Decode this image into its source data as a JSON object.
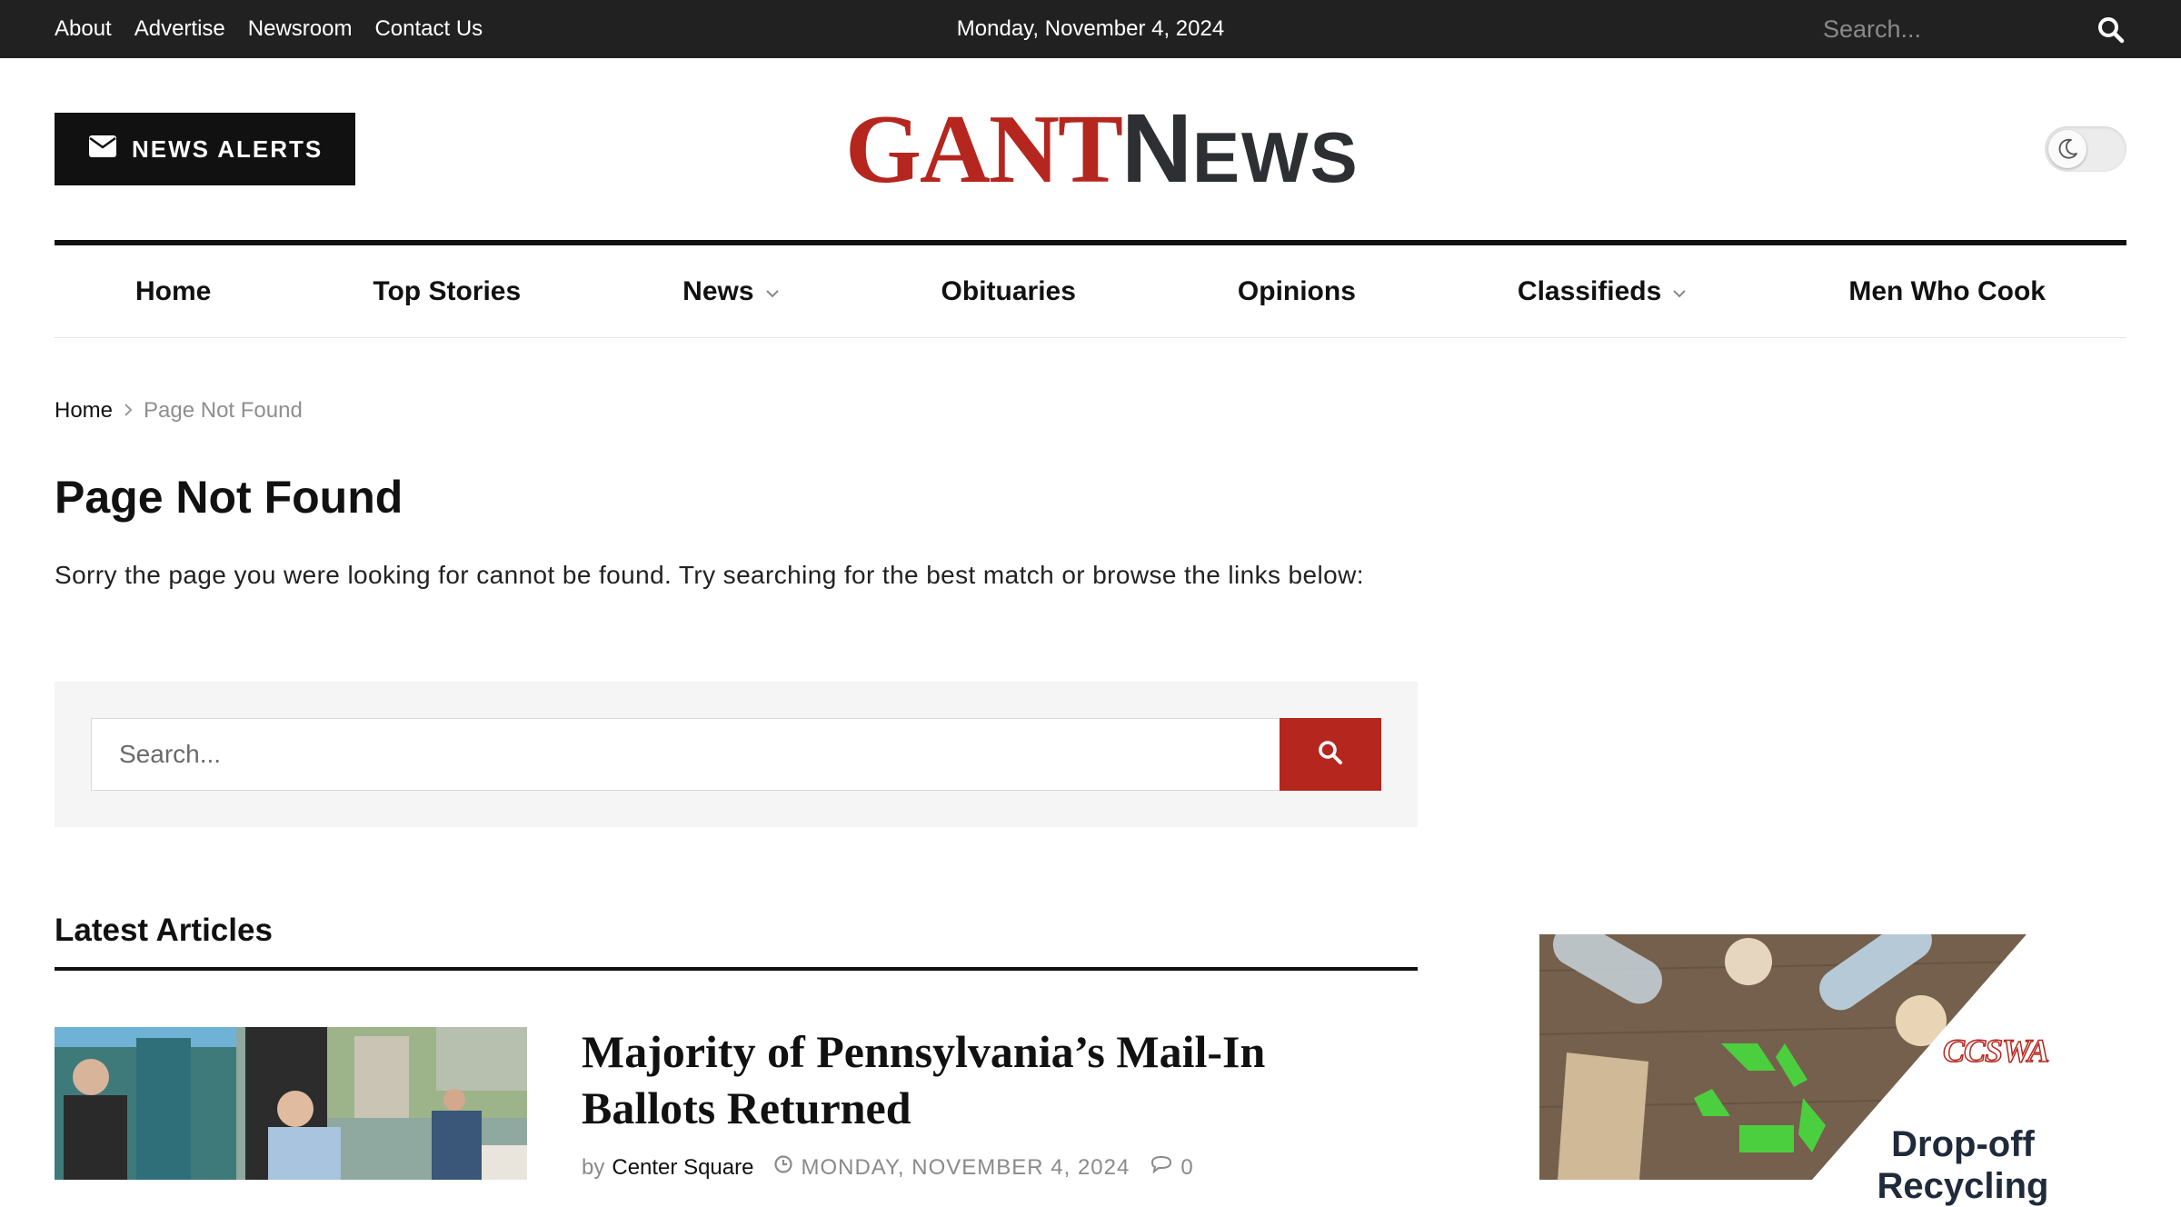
{
  "topbar": {
    "links": [
      "About",
      "Advertise",
      "Newsroom",
      "Contact Us"
    ],
    "date": "Monday, November 4, 2024",
    "search_placeholder": "Search..."
  },
  "header": {
    "alerts_label": "NEWS ALERTS",
    "logo": {
      "part1": "GANT",
      "part2": "N",
      "part3": "EWS"
    }
  },
  "nav": {
    "items": [
      {
        "label": "Home",
        "dropdown": false
      },
      {
        "label": "Top Stories",
        "dropdown": false
      },
      {
        "label": "News",
        "dropdown": true
      },
      {
        "label": "Obituaries",
        "dropdown": false
      },
      {
        "label": "Opinions",
        "dropdown": false
      },
      {
        "label": "Classifieds",
        "dropdown": true
      },
      {
        "label": "Men Who Cook",
        "dropdown": false
      }
    ]
  },
  "breadcrumb": {
    "home": "Home",
    "current": "Page Not Found"
  },
  "page": {
    "title": "Page Not Found",
    "message": "Sorry the page you were looking for cannot be found. Try searching for the best match or browse the links below:",
    "search_placeholder": "Search..."
  },
  "latest": {
    "heading": "Latest Articles",
    "articles": [
      {
        "title": "Majority of Pennsylvania’s Mail-In Ballots Returned",
        "by": "by",
        "author": "Center Square",
        "date": "MONDAY, NOVEMBER 4, 2024",
        "comments": "0"
      }
    ]
  },
  "ad": {
    "brand": "CCSWA",
    "text": "Drop-off Recycling"
  },
  "colors": {
    "brand_red": "#b5261e",
    "topbar_bg": "#212121",
    "text_dark": "#111111"
  }
}
